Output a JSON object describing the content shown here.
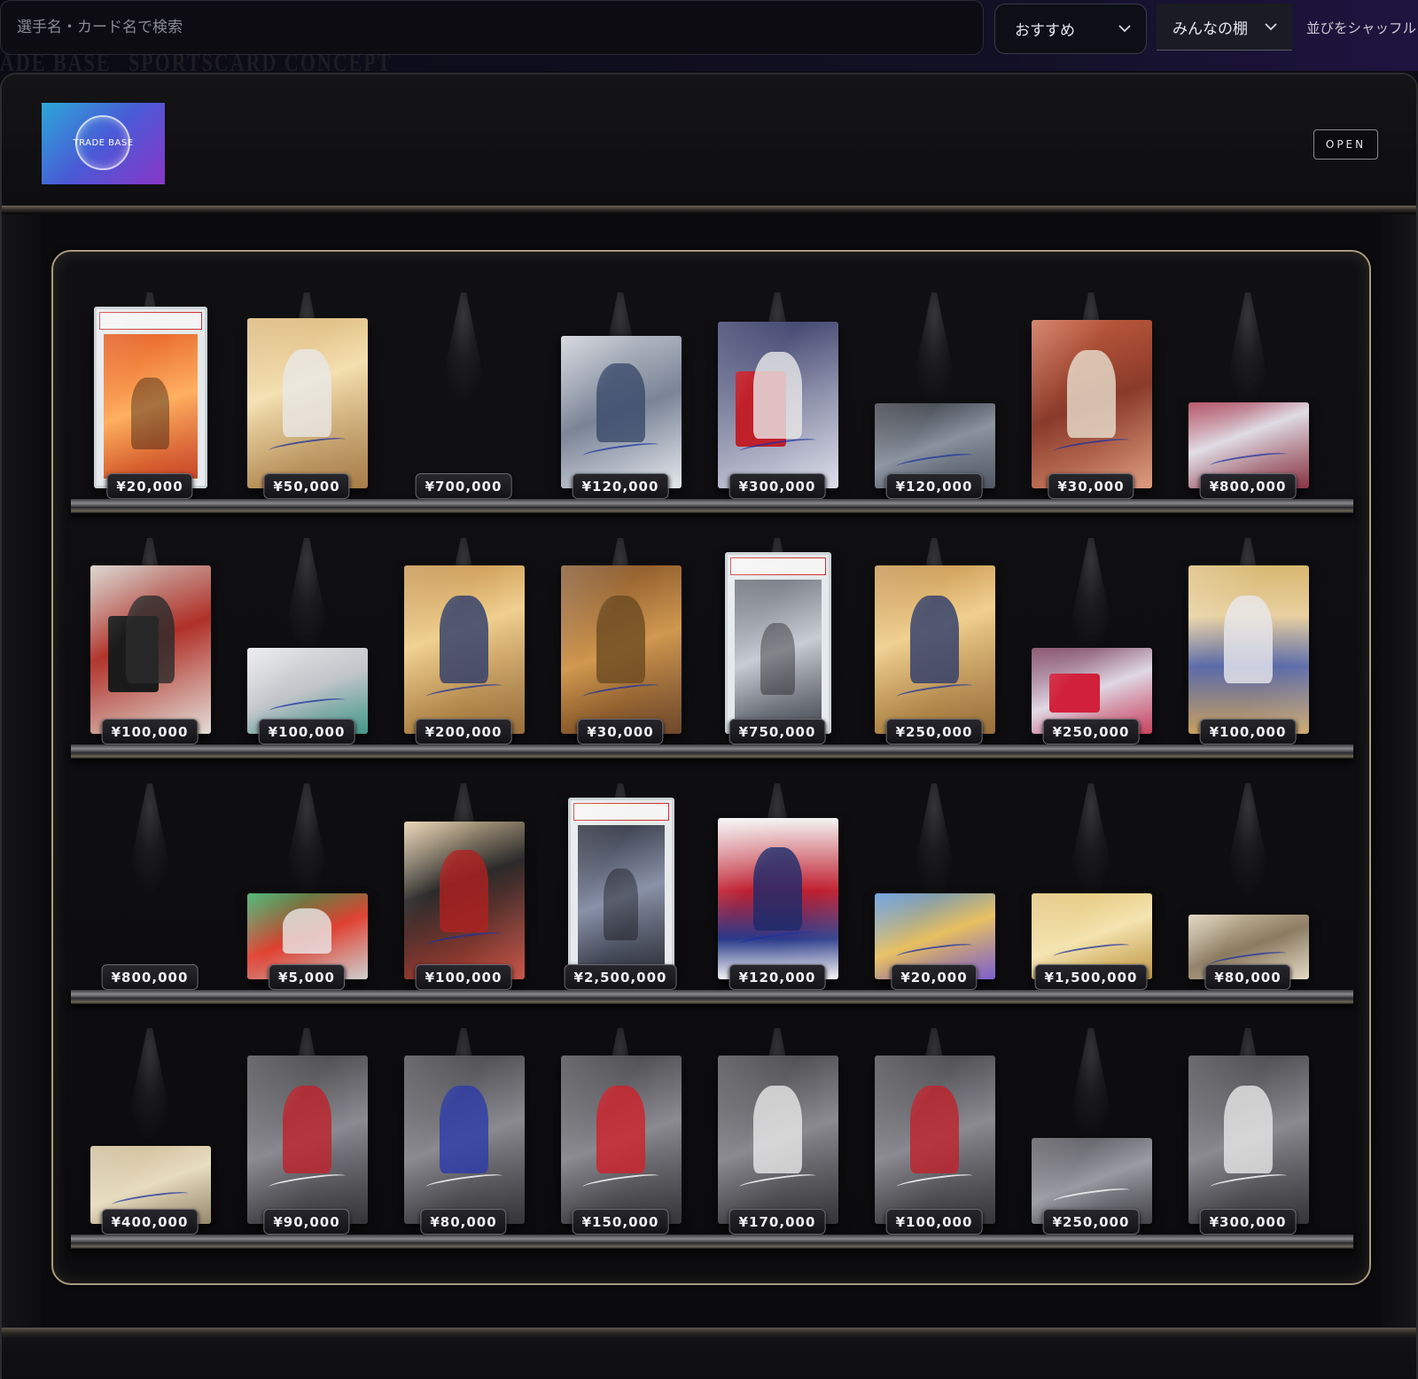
{
  "search": {
    "placeholder": "選手名・カード名で検索"
  },
  "sort_select": {
    "value": "おすすめ"
  },
  "shelf_select": {
    "value": "みんなの棚"
  },
  "shuffle_label": "並びをシャッフル",
  "store": {
    "logo_text": "TRADE BASE",
    "open_label": "OPEN"
  },
  "background_text": [
    "ADE BASE",
    "SPORTSCARD CONCEPT"
  ],
  "shelves": [
    {
      "items": [
        {
          "price": "¥20,000",
          "card": "slab-orange"
        },
        {
          "price": "¥50,000",
          "card": "gold-auto"
        },
        {
          "price": "¥700,000",
          "card": "empty"
        },
        {
          "price": "¥120,000",
          "card": "sketch"
        },
        {
          "price": "¥300,000",
          "card": "patch-red"
        },
        {
          "price": "¥120,000",
          "card": "dual-patch"
        },
        {
          "price": "¥30,000",
          "card": "auto-brown"
        },
        {
          "price": "¥800,000",
          "card": "inception-patch"
        }
      ]
    },
    {
      "items": [
        {
          "price": "¥100,000",
          "card": "zlatan-patch"
        },
        {
          "price": "¥100,000",
          "card": "felix-auto"
        },
        {
          "price": "¥200,000",
          "card": "gilded-griffey"
        },
        {
          "price": "¥30,000",
          "card": "gilded-oliva"
        },
        {
          "price": "¥750,000",
          "card": "slab-ronaldo"
        },
        {
          "price": "¥250,000",
          "card": "gilded-ichiro"
        },
        {
          "price": "¥250,000",
          "card": "patch-a"
        },
        {
          "price": "¥100,000",
          "card": "stars-stripes"
        }
      ]
    },
    {
      "items": [
        {
          "price": "¥800,000",
          "card": "empty"
        },
        {
          "price": "¥5,000",
          "card": "juve-prizm"
        },
        {
          "price": "¥100,000",
          "card": "gattuso"
        },
        {
          "price": "¥2,500,000",
          "card": "slab-messi"
        },
        {
          "price": "¥120,000",
          "card": "kurtz"
        },
        {
          "price": "¥20,000",
          "card": "prizm-auto"
        },
        {
          "price": "¥1,500,000",
          "card": "gold-auto-wide"
        },
        {
          "price": "¥80,000",
          "card": "allen-ginter"
        }
      ]
    },
    {
      "items": [
        {
          "price": "¥400,000",
          "card": "swoosh-patch"
        },
        {
          "price": "¥90,000",
          "card": "legends-torres"
        },
        {
          "price": "¥80,000",
          "card": "legends-lampard"
        },
        {
          "price": "¥150,000",
          "card": "legends-henry"
        },
        {
          "price": "¥170,000",
          "card": "legends-baggio"
        },
        {
          "price": "¥100,000",
          "card": "legends-gerrard"
        },
        {
          "price": "¥250,000",
          "card": "inception-auto"
        },
        {
          "price": "¥300,000",
          "card": "legends-zidane"
        }
      ]
    }
  ]
}
